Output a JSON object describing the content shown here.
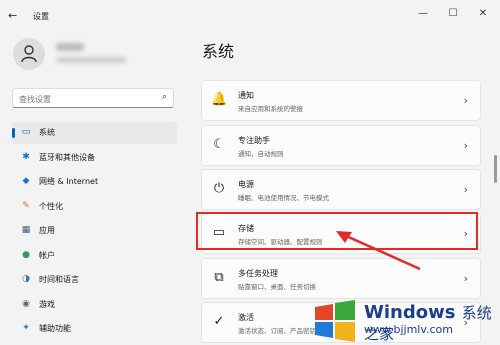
{
  "window": {
    "title": "设置",
    "back_icon": "←",
    "minimize": "—",
    "maximize": "☐",
    "close": "✕"
  },
  "sidebar": {
    "search_placeholder": "查找设置",
    "items": [
      {
        "label": "系统",
        "icon": "▭",
        "color": "#0067c0",
        "active": true
      },
      {
        "label": "蓝牙和其他设备",
        "icon": "✱",
        "color": "#0078d4"
      },
      {
        "label": "网络 & Internet",
        "icon": "◆",
        "color": "#1e6fd0"
      },
      {
        "label": "个性化",
        "icon": "✎",
        "color": "#d96a1d"
      },
      {
        "label": "应用",
        "icon": "▦",
        "color": "#3d5a80"
      },
      {
        "label": "帐户",
        "icon": "●",
        "color": "#2e9b5b"
      },
      {
        "label": "时间和语言",
        "icon": "◑",
        "color": "#2f6fb8"
      },
      {
        "label": "游戏",
        "icon": "◉",
        "color": "#666"
      },
      {
        "label": "辅助功能",
        "icon": "✦",
        "color": "#2b78c4"
      }
    ]
  },
  "main": {
    "title": "系统",
    "cards": [
      {
        "title": "通知",
        "subtitle": "来自应用和系统的警报",
        "icon": "🔔"
      },
      {
        "title": "专注助手",
        "subtitle": "通知，自动规则",
        "icon": "☾"
      },
      {
        "title": "电源",
        "subtitle": "睡眠、电池使用情况、节电模式",
        "icon": "⏻"
      },
      {
        "title": "存储",
        "subtitle": "存储空间、驱动器、配置规则",
        "icon": "▭"
      },
      {
        "title": "多任务处理",
        "subtitle": "贴靠窗口、桌面、任务切换",
        "icon": "⧉"
      },
      {
        "title": "激活",
        "subtitle": "激活状态、订阅、产品密钥",
        "icon": "✓"
      }
    ]
  },
  "watermark": {
    "title": "Windows",
    "subtitle": "系统之家",
    "url": "www.bjjmlv.com"
  }
}
